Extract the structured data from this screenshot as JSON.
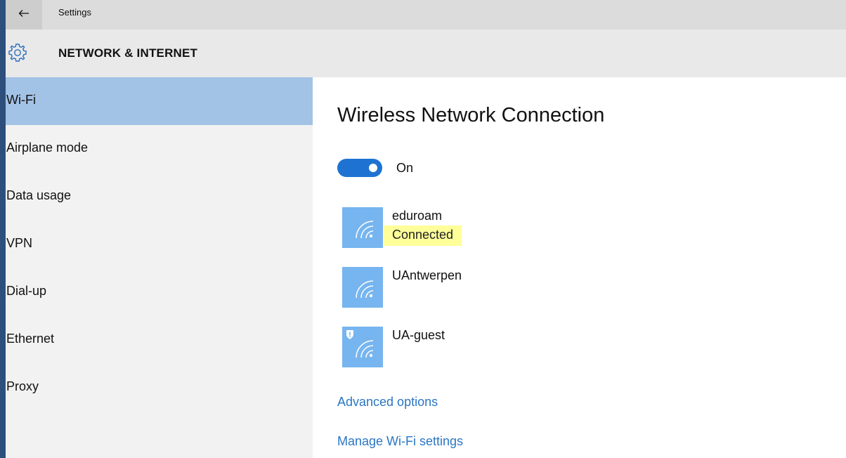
{
  "titlebar": {
    "back_icon": "arrow-left-icon",
    "title": "Settings"
  },
  "header": {
    "icon": "gear-icon",
    "title": "NETWORK & INTERNET"
  },
  "sidebar": {
    "items": [
      {
        "label": "Wi-Fi",
        "active": true
      },
      {
        "label": "Airplane mode",
        "active": false
      },
      {
        "label": "Data usage",
        "active": false
      },
      {
        "label": "VPN",
        "active": false
      },
      {
        "label": "Dial-up",
        "active": false
      },
      {
        "label": "Ethernet",
        "active": false
      },
      {
        "label": "Proxy",
        "active": false
      }
    ]
  },
  "main": {
    "title": "Wireless Network Connection",
    "toggle": {
      "state": "On",
      "on": true,
      "color": "#1e73d2"
    },
    "networks": [
      {
        "name": "eduroam",
        "status": "Connected",
        "icon": "wifi-signal-icon",
        "secured_badge": false
      },
      {
        "name": "UAntwerpen",
        "status": "",
        "icon": "wifi-signal-icon",
        "secured_badge": false
      },
      {
        "name": "UA-guest",
        "status": "",
        "icon": "wifi-signal-shield-icon",
        "secured_badge": true
      }
    ],
    "links": {
      "advanced": "Advanced options",
      "manage": "Manage Wi-Fi settings"
    }
  },
  "colors": {
    "accent": "#1e73d2",
    "nav_active": "#a2c2e6",
    "tile": "#76b5ef",
    "link": "#2a76c5",
    "highlight": "#ffff9a"
  }
}
